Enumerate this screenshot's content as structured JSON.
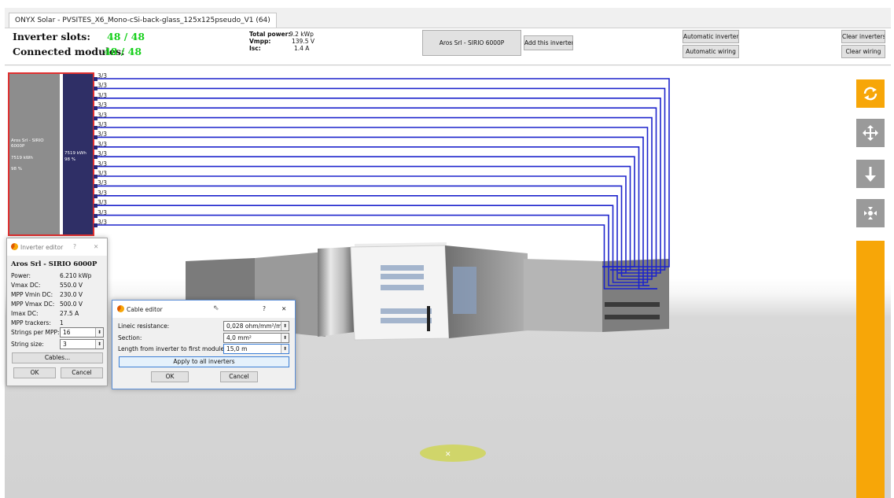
{
  "window": {
    "tab_title": "ONYX Solar - PVSITES_X6_Mono-cSi-back-glass_125x125pseudo_V1 (64)"
  },
  "summary": {
    "inverter_slots_label": "Inverter slots:",
    "inverter_slots_value": "48 / 48",
    "connected_modules_label": "Connected modules:",
    "connected_modules_value": "48 / 48",
    "total_power_label": "Total power:",
    "total_power_value": "9.2 kWp",
    "vmpp_label": "Vmpp:",
    "vmpp_value": "139.5 V",
    "isc_label": "Isc:",
    "isc_value": "1.4 A"
  },
  "toolbar": {
    "inverter_select": "Aros Srl - SIRIO 6000P",
    "add_inverter": "Add this inverter",
    "automatic_inverters": "Automatic inverters",
    "automatic_wiring": "Automatic wiring",
    "clear_inverters": "Clear inverters",
    "clear_wiring": "Clear wiring"
  },
  "inverter_block": {
    "name": "Aros Srl - SIRIO 6000P",
    "energy": "7519 kWh",
    "efficiency": "98 %",
    "mppt_energy": "7519 kWh",
    "mppt_efficiency": "98 %",
    "string_labels": [
      "3/3",
      "3/3",
      "3/3",
      "3/3",
      "3/3",
      "3/3",
      "3/3",
      "3/3",
      "3/3",
      "3/3",
      "3/3",
      "3/3",
      "3/3",
      "3/3",
      "3/3",
      "3/3"
    ]
  },
  "inverter_editor": {
    "title": "Inverter editor",
    "help": "?",
    "close": "✕",
    "model": "Aros Srl - SIRIO 6000P",
    "power_label": "Power:",
    "power_value": "6.210 kWp",
    "vmax_label": "Vmax DC:",
    "vmax_value": "550.0 V",
    "vmin_label": "MPP Vmin DC:",
    "vmin_value": "230.0 V",
    "mppvmax_label": "MPP Vmax DC:",
    "mppvmax_value": "500.0 V",
    "imax_label": "Imax DC:",
    "imax_value": "27.5 A",
    "trackers_label": "MPP trackers:",
    "trackers_value": "1",
    "strings_label": "Strings per MPP:",
    "strings_value": "16",
    "string_size_label": "String size:",
    "string_size_value": "3",
    "cables_button": "Cables...",
    "ok": "OK",
    "cancel": "Cancel"
  },
  "cable_editor": {
    "title": "Cable editor",
    "help": "?",
    "close": "✕",
    "resistance_label": "Lineic resistance:",
    "resistance_value": "0,028 ohm/mm²/m",
    "section_label": "Section:",
    "section_value": "4,0 mm²",
    "length_label": "Length from inverter to first module:",
    "length_value": "15,0 m",
    "apply_all": "Apply to all inverters",
    "ok": "OK",
    "cancel": "Cancel"
  },
  "right_toolbar": {
    "rotate": "rotate-icon",
    "pan": "move-icon",
    "down": "arrow-down-icon",
    "fit": "fit-view-icon"
  },
  "colors": {
    "accent_orange": "#f7a608",
    "wire_blue": "#1d24cc",
    "green_value": "#19d01e",
    "inverter_red": "#e03030"
  }
}
